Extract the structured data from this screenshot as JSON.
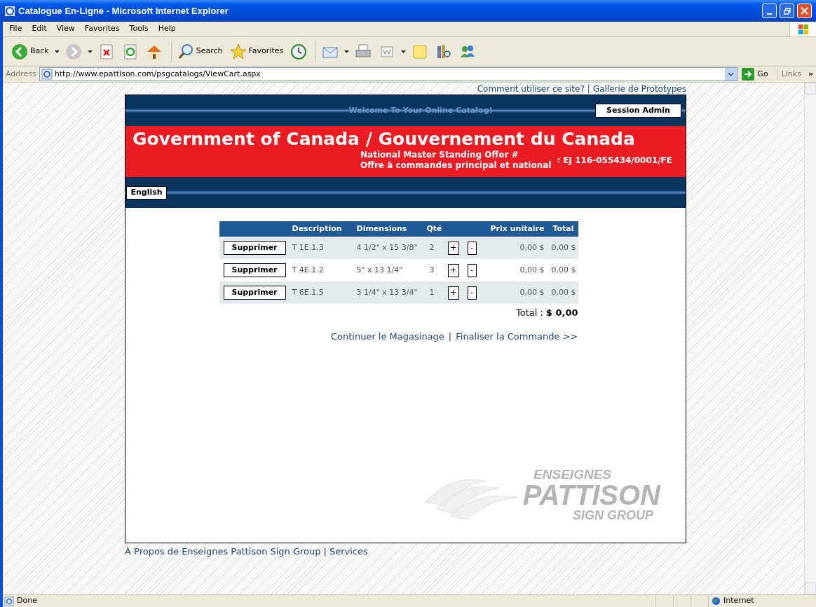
{
  "window": {
    "title": "Catalogue En-Ligne - Microsoft Internet Explorer"
  },
  "menu": [
    "File",
    "Edit",
    "View",
    "Favorites",
    "Tools",
    "Help"
  ],
  "toolbar": [
    {
      "kind": "back",
      "label": "Back"
    },
    {
      "kind": "forward"
    },
    {
      "kind": "stop"
    },
    {
      "kind": "refresh"
    },
    {
      "kind": "home"
    },
    {
      "kind": "search",
      "label": "Search"
    },
    {
      "kind": "favorites",
      "label": "Favorites"
    },
    {
      "kind": "history"
    },
    {
      "kind": "mail"
    },
    {
      "kind": "print"
    },
    {
      "kind": "edit"
    },
    {
      "kind": "note"
    },
    {
      "kind": "research"
    },
    {
      "kind": "messenger"
    }
  ],
  "address": {
    "label": "Address",
    "url": "http://www.epattison.com/psgcatalogs/ViewCart.aspx",
    "go": "Go",
    "links": "Links",
    "more": "»"
  },
  "top_links": [
    "Comment utiliser ce site?",
    "Gallerie de Prototypes"
  ],
  "separator": "|",
  "header": {
    "welcome": "Welcome To Your Online Catalog!",
    "session_button": "Session Admin",
    "title": "Government of Canada / Gouvernement du Canada",
    "offer_lines": [
      "National Master Standing Offer #",
      "Offre à commandes principal et national"
    ],
    "offer_number": ": EJ 116-055434/0001/FE",
    "language_button": "English"
  },
  "table": {
    "columns": [
      "Description",
      "Dimensions",
      "Qté",
      "Prix unitaire",
      "Total"
    ],
    "rows": [
      {
        "button": "Supprimer",
        "description": "T 1E.1.3",
        "dimensions": "4 1/2\" x 15 3/8\"",
        "qty": "2",
        "plus": "+",
        "minus": "-",
        "unit_price": "0,00 $",
        "total": "0,00 $"
      },
      {
        "button": "Supprimer",
        "description": "T 4E.1.2",
        "dimensions": "5\" x 13 1/4\"",
        "qty": "3",
        "plus": "+",
        "minus": "-",
        "unit_price": "0,00 $",
        "total": "0,00 $"
      },
      {
        "button": "Supprimer",
        "description": "T 6E.1.5",
        "dimensions": "3 1/4\" x 13 3/4\"",
        "qty": "1",
        "plus": "+",
        "minus": "-",
        "unit_price": "0,00 $",
        "total": "0,00 $"
      }
    ],
    "total_label": "Total :",
    "total_value": "$ 0,00"
  },
  "actions": [
    "Continuer le Magasinage",
    "Finaliser la Commande >>"
  ],
  "logo": [
    "ENSEIGNES",
    "PATTISON",
    "SIGN GROUP"
  ],
  "footer_links": [
    "À Propos de Enseignes Pattison Sign Group",
    "Services"
  ],
  "status_bar": {
    "text": "Done",
    "zone": "Internet"
  }
}
